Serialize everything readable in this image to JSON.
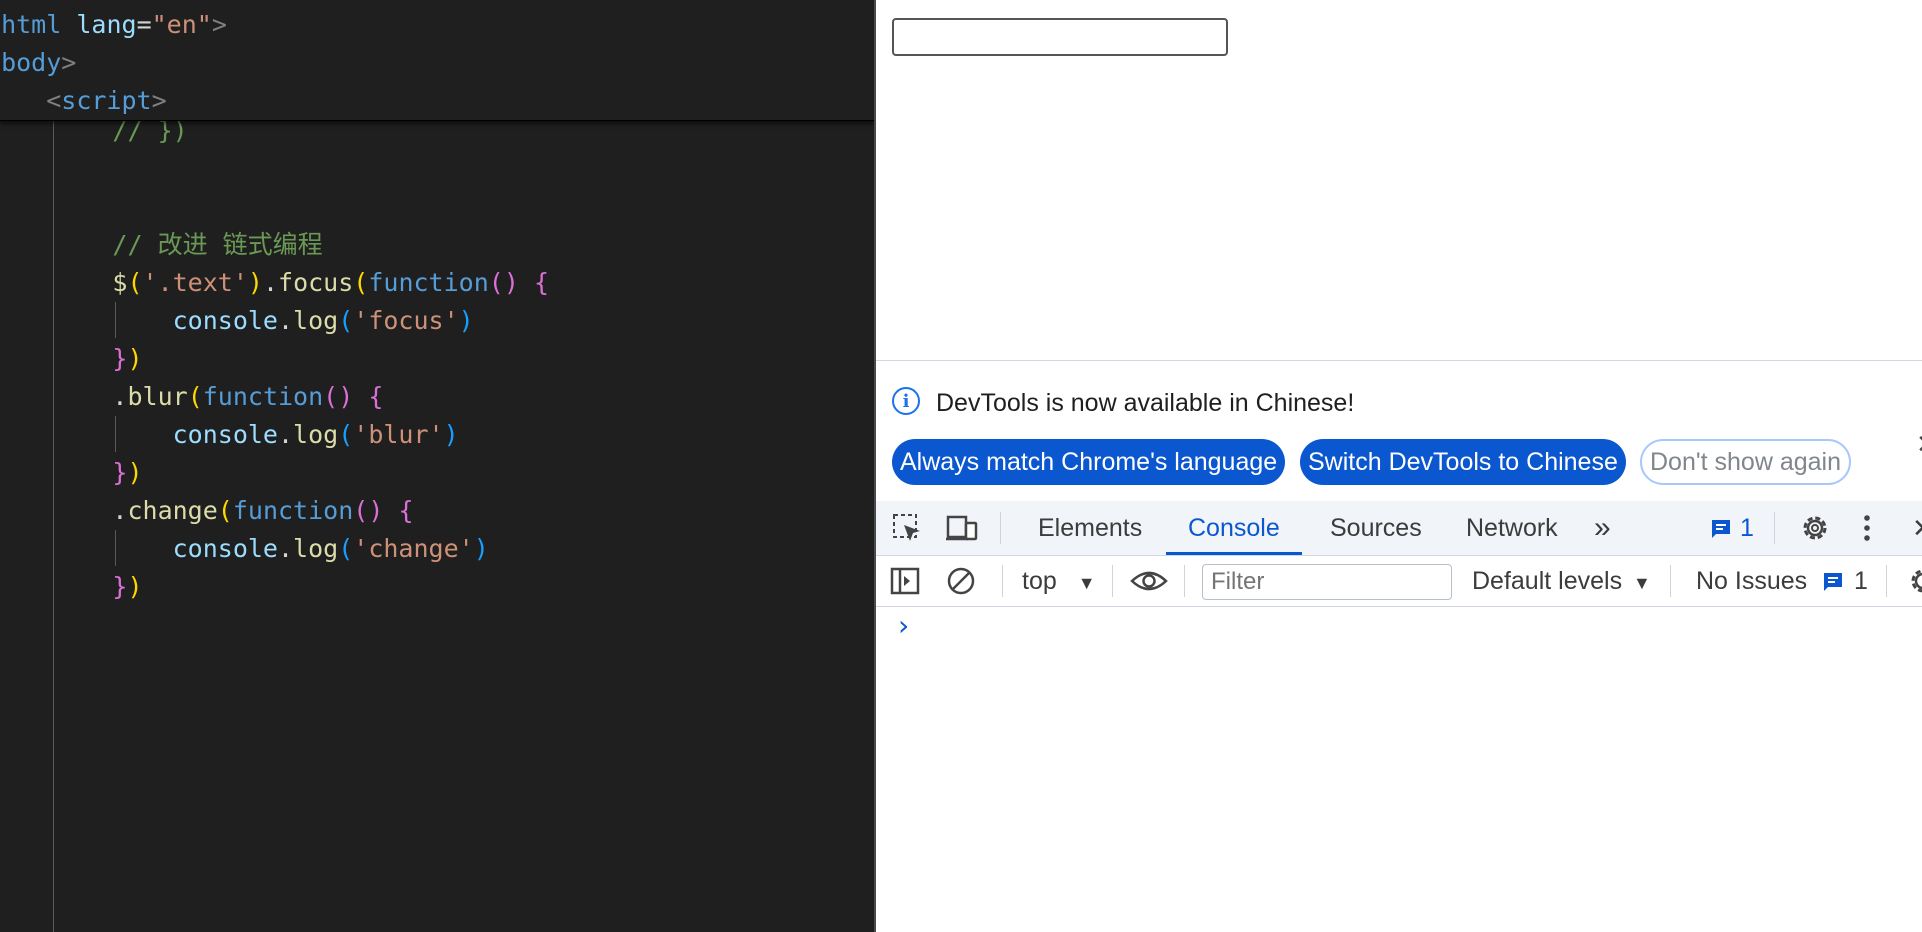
{
  "editor": {
    "sticky_lines": [
      {
        "parts": [
          {
            "t": "<",
            "c": "c-tag"
          },
          {
            "t": "html",
            "c": "c-name"
          },
          {
            "t": " ",
            "c": "c-w"
          },
          {
            "t": "lang",
            "c": "c-attr"
          },
          {
            "t": "=",
            "c": "c-w"
          },
          {
            "t": "\"en\"",
            "c": "c-str"
          },
          {
            "t": ">",
            "c": "c-tag"
          }
        ]
      },
      {
        "parts": [
          {
            "t": "<",
            "c": "c-tag"
          },
          {
            "t": "body",
            "c": "c-name"
          },
          {
            "t": ">",
            "c": "c-tag"
          }
        ]
      },
      {
        "parts": [
          {
            "t": "    <",
            "c": "c-tag"
          },
          {
            "t": "script",
            "c": "c-name"
          },
          {
            "t": ">",
            "c": "c-tag"
          }
        ]
      }
    ],
    "code_lines": [
      {
        "parts": [
          {
            "t": "        // })",
            "c": "c-com"
          }
        ]
      },
      {
        "parts": []
      },
      {
        "parts": []
      },
      {
        "parts": [
          {
            "t": "        // 改进 链式编程",
            "c": "c-com"
          }
        ]
      },
      {
        "parts": [
          {
            "t": "        $",
            "c": "c-fn"
          },
          {
            "t": "(",
            "c": "c-p1"
          },
          {
            "t": "'.text'",
            "c": "c-str"
          },
          {
            "t": ")",
            "c": "c-p1"
          },
          {
            "t": ".",
            "c": "c-w"
          },
          {
            "t": "focus",
            "c": "c-fn"
          },
          {
            "t": "(",
            "c": "c-p1"
          },
          {
            "t": "function",
            "c": "c-kw"
          },
          {
            "t": "()",
            "c": "c-p2"
          },
          {
            "t": " ",
            "c": "c-w"
          },
          {
            "t": "{",
            "c": "c-p2"
          }
        ]
      },
      {
        "parts": [
          {
            "t": "            console",
            "c": "c-var"
          },
          {
            "t": ".",
            "c": "c-w"
          },
          {
            "t": "log",
            "c": "c-fn"
          },
          {
            "t": "(",
            "c": "c-p3"
          },
          {
            "t": "'focus'",
            "c": "c-str"
          },
          {
            "t": ")",
            "c": "c-p3"
          }
        ]
      },
      {
        "parts": [
          {
            "t": "        }",
            "c": "c-p2"
          },
          {
            "t": ")",
            "c": "c-p1"
          }
        ]
      },
      {
        "parts": [
          {
            "t": "        .",
            "c": "c-w"
          },
          {
            "t": "blur",
            "c": "c-fn"
          },
          {
            "t": "(",
            "c": "c-p1"
          },
          {
            "t": "function",
            "c": "c-kw"
          },
          {
            "t": "()",
            "c": "c-p2"
          },
          {
            "t": " ",
            "c": "c-w"
          },
          {
            "t": "{",
            "c": "c-p2"
          }
        ]
      },
      {
        "parts": [
          {
            "t": "            console",
            "c": "c-var"
          },
          {
            "t": ".",
            "c": "c-w"
          },
          {
            "t": "log",
            "c": "c-fn"
          },
          {
            "t": "(",
            "c": "c-p3"
          },
          {
            "t": "'blur'",
            "c": "c-str"
          },
          {
            "t": ")",
            "c": "c-p3"
          }
        ]
      },
      {
        "parts": [
          {
            "t": "        }",
            "c": "c-p2"
          },
          {
            "t": ")",
            "c": "c-p1"
          }
        ]
      },
      {
        "parts": [
          {
            "t": "        .",
            "c": "c-w"
          },
          {
            "t": "change",
            "c": "c-fn"
          },
          {
            "t": "(",
            "c": "c-p1"
          },
          {
            "t": "function",
            "c": "c-kw"
          },
          {
            "t": "()",
            "c": "c-p2"
          },
          {
            "t": " ",
            "c": "c-w"
          },
          {
            "t": "{",
            "c": "c-p2"
          }
        ]
      },
      {
        "parts": [
          {
            "t": "            console",
            "c": "c-var"
          },
          {
            "t": ".",
            "c": "c-w"
          },
          {
            "t": "log",
            "c": "c-fn"
          },
          {
            "t": "(",
            "c": "c-p3"
          },
          {
            "t": "'change'",
            "c": "c-str"
          },
          {
            "t": ")",
            "c": "c-p3"
          }
        ]
      },
      {
        "parts": [
          {
            "t": "        }",
            "c": "c-p2"
          },
          {
            "t": ")",
            "c": "c-p1"
          }
        ]
      }
    ]
  },
  "devtools": {
    "banner": {
      "message": "DevTools is now available in Chinese!",
      "btn_match": "Always match Chrome's language",
      "btn_switch": "Switch DevTools to Chinese",
      "btn_dismiss": "Don't show again"
    },
    "tabs": {
      "elements": "Elements",
      "console": "Console",
      "sources": "Sources",
      "network": "Network",
      "more": "»",
      "message_count": "1"
    },
    "console_toolbar": {
      "context": "top",
      "filter_placeholder": "Filter",
      "levels": "Default levels",
      "issues_label": "No Issues",
      "issues_count": "1"
    },
    "prompt": "›"
  },
  "colors": {
    "accent": "#0b57d0",
    "editor_bg": "#1f1f1f"
  }
}
